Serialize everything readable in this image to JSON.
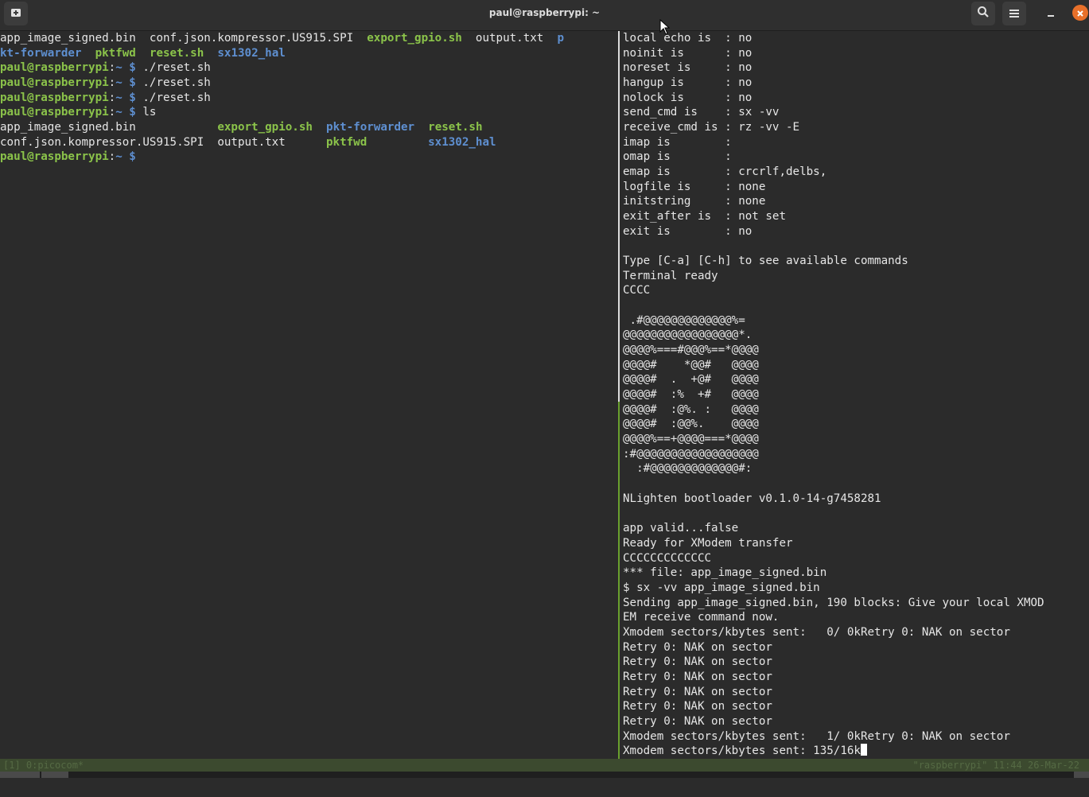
{
  "window": {
    "title": "paul@raspberrypi: ~",
    "icons": [
      "new-tab-icon",
      "search-icon",
      "hamburger-menu-icon",
      "minimize-icon",
      "close-icon"
    ]
  },
  "left_pane": {
    "lines": [
      [
        {
          "t": "app_image_signed.bin  conf.json.kompressor.US915.SPI  ",
          "c": ""
        },
        {
          "t": "export_gpio.sh",
          "c": "gb"
        },
        {
          "t": "  output.txt  ",
          "c": ""
        },
        {
          "t": "p",
          "c": "bb"
        }
      ],
      [
        {
          "t": "kt-forwarder",
          "c": "bb"
        },
        {
          "t": "  ",
          "c": ""
        },
        {
          "t": "pktfwd",
          "c": "gb"
        },
        {
          "t": "  ",
          "c": ""
        },
        {
          "t": "reset.sh",
          "c": "gb"
        },
        {
          "t": "  ",
          "c": ""
        },
        {
          "t": "sx1302_hal",
          "c": "bb"
        }
      ],
      [
        {
          "t": "paul@raspberrypi",
          "c": "gb"
        },
        {
          "t": ":",
          "c": ""
        },
        {
          "t": "~ $",
          "c": "bb"
        },
        {
          "t": " ./reset.sh",
          "c": ""
        }
      ],
      [
        {
          "t": "paul@raspberrypi",
          "c": "gb"
        },
        {
          "t": ":",
          "c": ""
        },
        {
          "t": "~ $",
          "c": "bb"
        },
        {
          "t": " ./reset.sh",
          "c": ""
        }
      ],
      [
        {
          "t": "paul@raspberrypi",
          "c": "gb"
        },
        {
          "t": ":",
          "c": ""
        },
        {
          "t": "~ $",
          "c": "bb"
        },
        {
          "t": " ./reset.sh",
          "c": ""
        }
      ],
      [
        {
          "t": "paul@raspberrypi",
          "c": "gb"
        },
        {
          "t": ":",
          "c": ""
        },
        {
          "t": "~ $",
          "c": "bb"
        },
        {
          "t": " ls",
          "c": ""
        }
      ],
      [
        {
          "t": "app_image_signed.bin            ",
          "c": ""
        },
        {
          "t": "export_gpio.sh",
          "c": "gb"
        },
        {
          "t": "  ",
          "c": ""
        },
        {
          "t": "pkt-forwarder",
          "c": "bb"
        },
        {
          "t": "  ",
          "c": ""
        },
        {
          "t": "reset.sh",
          "c": "gb"
        }
      ],
      [
        {
          "t": "conf.json.kompressor.US915.SPI  output.txt      ",
          "c": ""
        },
        {
          "t": "pktfwd",
          "c": "gb"
        },
        {
          "t": "         ",
          "c": ""
        },
        {
          "t": "sx1302_hal",
          "c": "bb"
        }
      ],
      [
        {
          "t": "paul@raspberrypi",
          "c": "gb"
        },
        {
          "t": ":",
          "c": ""
        },
        {
          "t": "~ $",
          "c": "bb"
        },
        {
          "t": " ",
          "c": ""
        }
      ]
    ]
  },
  "right_pane": {
    "lines": [
      "local echo is  : no",
      "noinit is      : no",
      "noreset is     : no",
      "hangup is      : no",
      "nolock is      : no",
      "send_cmd is    : sx -vv",
      "receive_cmd is : rz -vv -E",
      "imap is        :",
      "omap is        :",
      "emap is        : crcrlf,delbs,",
      "logfile is     : none",
      "initstring     : none",
      "exit_after is  : not set",
      "exit is        : no",
      "",
      "Type [C-a] [C-h] to see available commands",
      "Terminal ready",
      "CCCC",
      "",
      " .#@@@@@@@@@@@@@%=",
      "@@@@@@@@@@@@@@@@@*.",
      "@@@@%===#@@@%==*@@@@",
      "@@@@#    *@@#   @@@@",
      "@@@@#  .  +@#   @@@@",
      "@@@@#  :%  +#   @@@@",
      "@@@@#  :@%. :   @@@@",
      "@@@@#  :@@%.    @@@@",
      "@@@@%==+@@@@===*@@@@",
      ":#@@@@@@@@@@@@@@@@@@",
      "  :#@@@@@@@@@@@@@#:",
      "",
      "NLighten bootloader v0.1.0-14-g7458281",
      "",
      "app valid...false",
      "Ready for XModem transfer",
      "CCCCCCCCCCCCC",
      "*** file: app_image_signed.bin",
      "$ sx -vv app_image_signed.bin",
      "Sending app_image_signed.bin, 190 blocks: Give your local XMOD",
      "EM receive command now.",
      "Xmodem sectors/kbytes sent:   0/ 0kRetry 0: NAK on sector",
      "Retry 0: NAK on sector",
      "Retry 0: NAK on sector",
      "Retry 0: NAK on sector",
      "Retry 0: NAK on sector",
      "Retry 0: NAK on sector",
      "Retry 0: NAK on sector",
      "Xmodem sectors/kbytes sent:   1/ 0kRetry 0: NAK on sector",
      "Xmodem sectors/kbytes sent: 135/16k"
    ]
  },
  "statusbar": {
    "left": "[1] 0:picocom*",
    "right": "\"raspberrypi\" 11:44 26-Mar-22"
  }
}
